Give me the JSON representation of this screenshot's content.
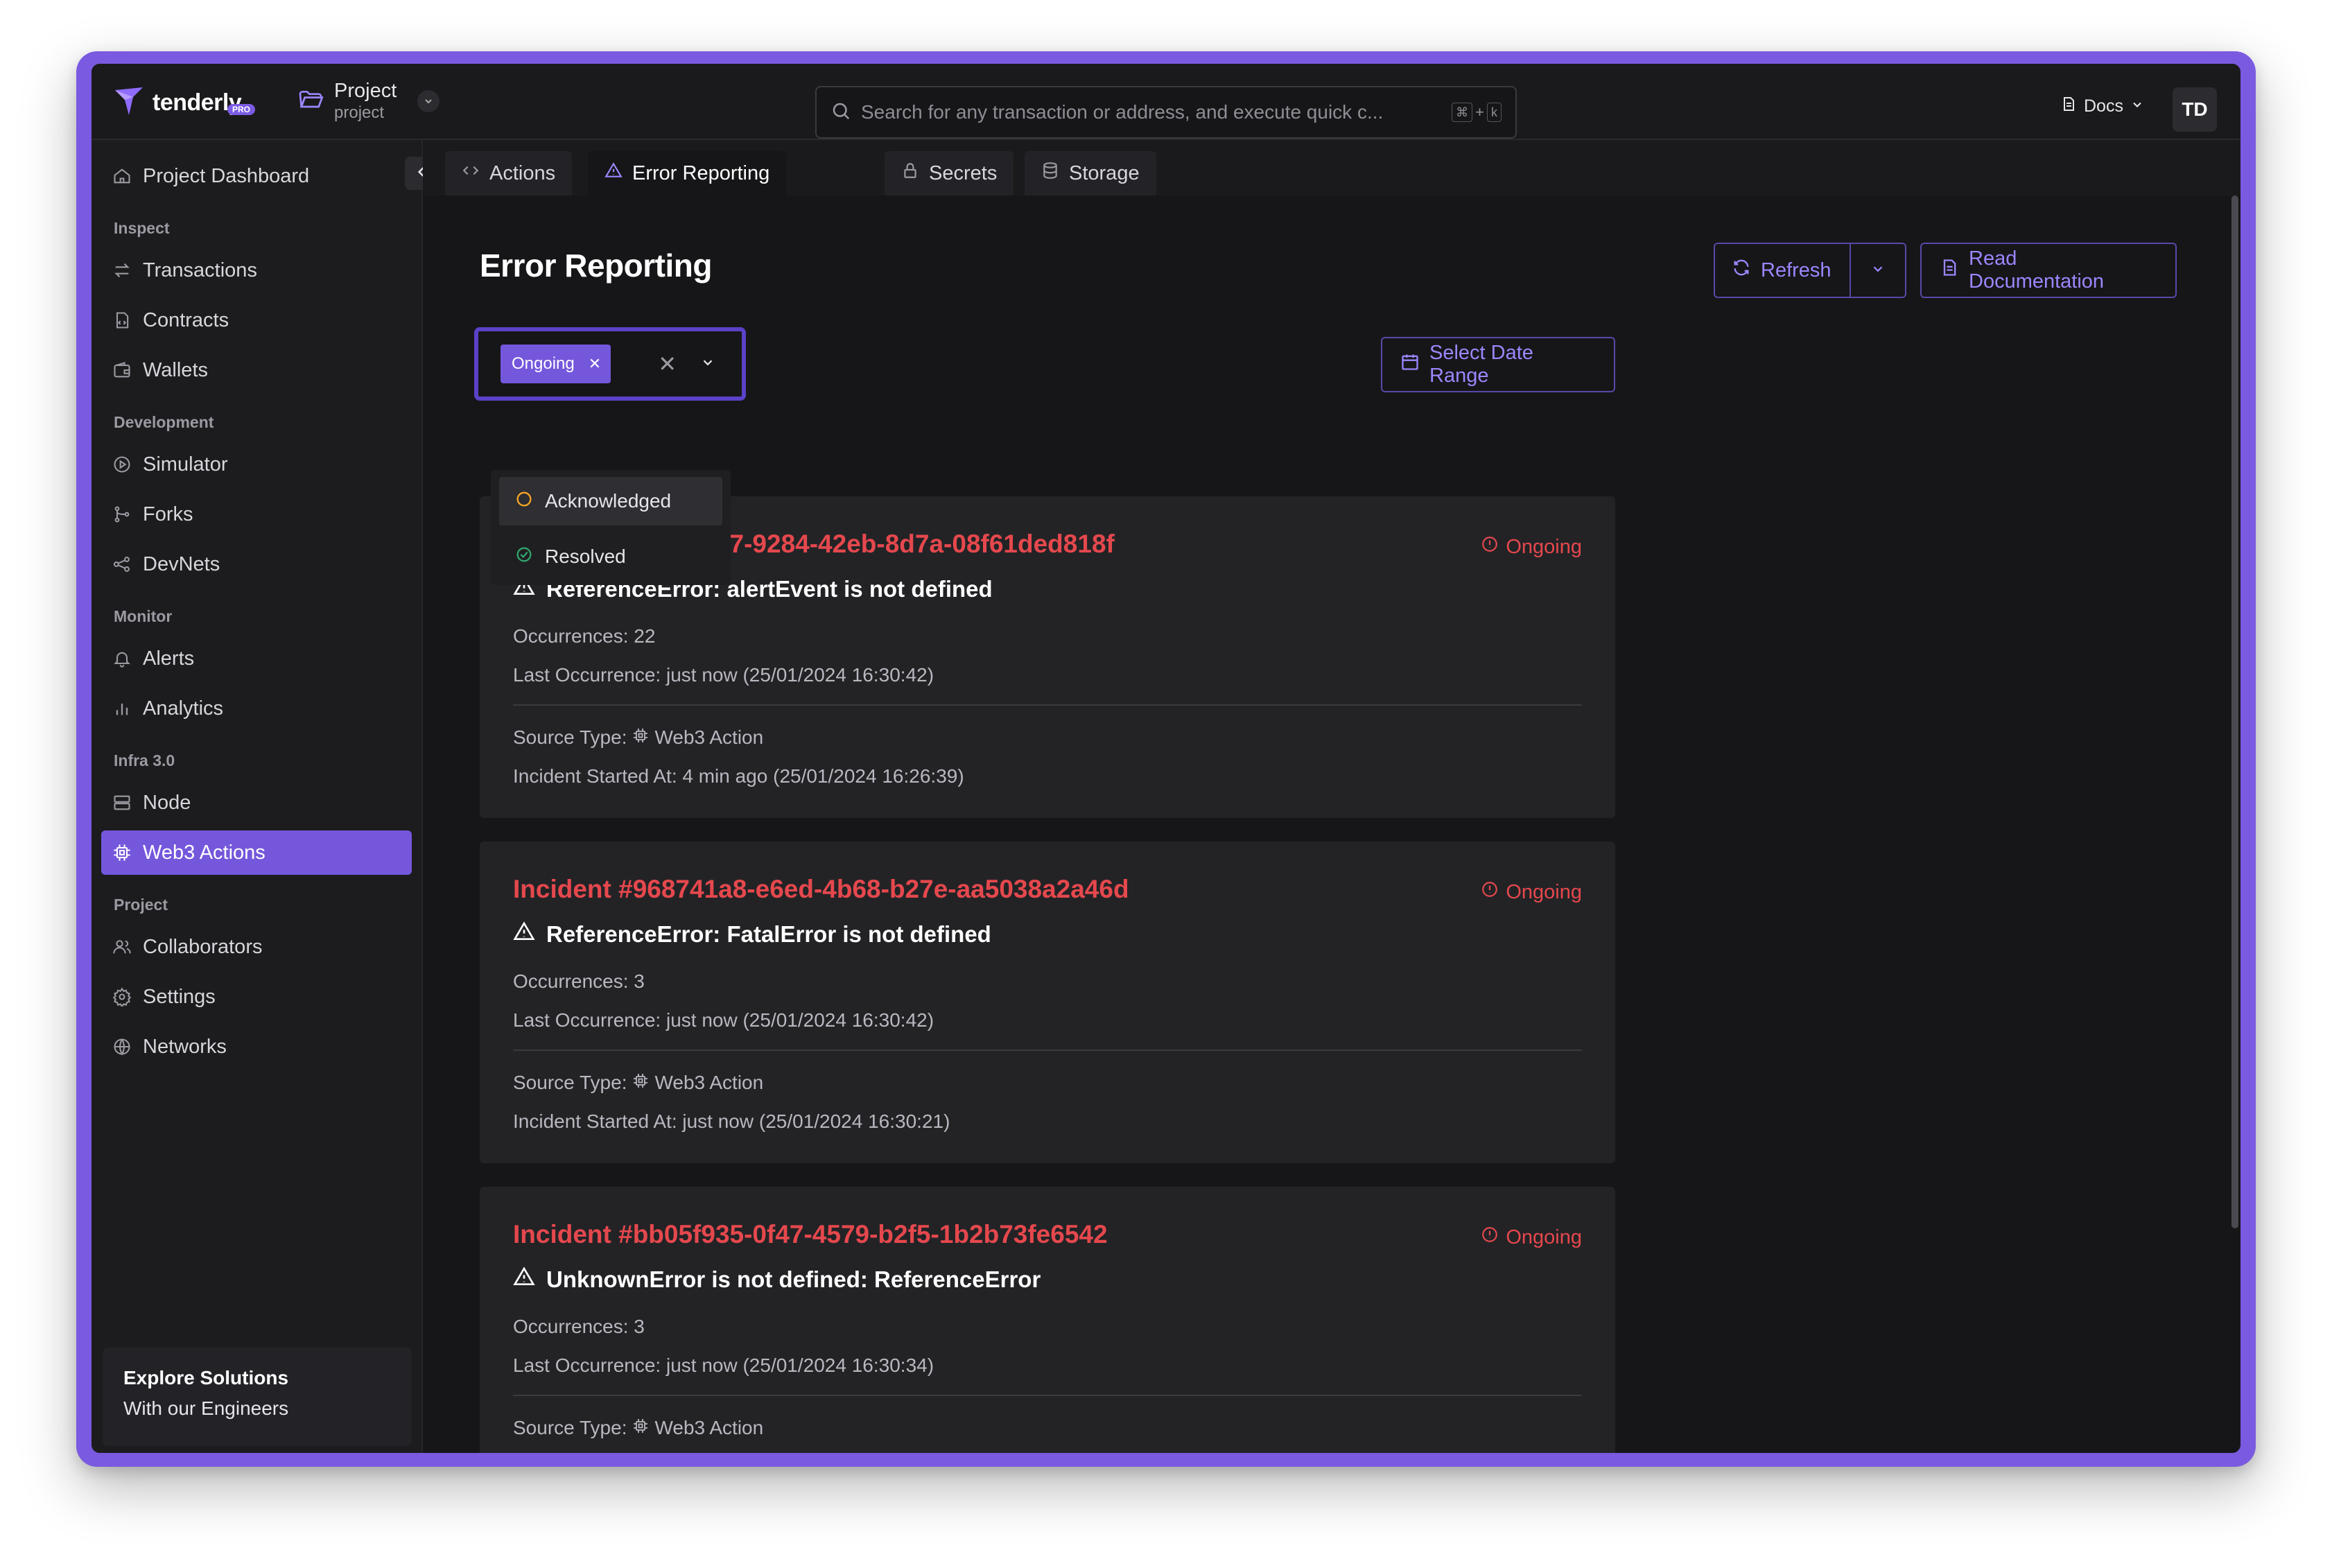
{
  "app": {
    "logo_text": "tenderly",
    "logo_badge": "PRO",
    "project_name": "Project",
    "project_sub": "project",
    "avatar_initials": "TD",
    "docs_label": "Docs"
  },
  "search": {
    "placeholder": "Search for any transaction or address, and execute quick c...",
    "shortcut_key1": "⌘",
    "shortcut_plus": "+",
    "shortcut_key2": "k"
  },
  "sidebar": {
    "dashboard": "Project Dashboard",
    "sections": {
      "inspect": "Inspect",
      "development": "Development",
      "monitor": "Monitor",
      "infra": "Infra 3.0",
      "project": "Project"
    },
    "items": {
      "transactions": "Transactions",
      "contracts": "Contracts",
      "wallets": "Wallets",
      "simulator": "Simulator",
      "forks": "Forks",
      "devnets": "DevNets",
      "alerts": "Alerts",
      "analytics": "Analytics",
      "node": "Node",
      "web3_actions": "Web3 Actions",
      "collaborators": "Collaborators",
      "settings": "Settings",
      "networks": "Networks"
    },
    "explore_title": "Explore Solutions",
    "explore_sub": "With our Engineers"
  },
  "tabs": [
    {
      "label": "Actions"
    },
    {
      "label": "Error Reporting"
    },
    {
      "label": "Secrets"
    },
    {
      "label": "Storage"
    }
  ],
  "main": {
    "title": "Error Reporting",
    "refresh_label": "Refresh",
    "docs_label": "Read Documentation",
    "date_range_label": "Select Date Range"
  },
  "filter": {
    "selected_chip": "Ongoing",
    "options": [
      {
        "label": "Acknowledged"
      },
      {
        "label": "Resolved"
      }
    ]
  },
  "incidents": [
    {
      "title": "Incident #f4b86b17-9284-42eb-8d7a-08f61ded818f",
      "status": "Ongoing",
      "error": "ReferenceError: alertEvent is not defined",
      "occurrences": "Occurrences: 22",
      "last_occurrence": "Last Occurrence: just now (25/01/2024 16:30:42)",
      "source_prefix": "Source Type:",
      "source_type": "Web3 Action",
      "started_at": "Incident Started At: 4 min ago (25/01/2024 16:26:39)"
    },
    {
      "title": "Incident #968741a8-e6ed-4b68-b27e-aa5038a2a46d",
      "status": "Ongoing",
      "error": "ReferenceError: FatalError is not defined",
      "occurrences": "Occurrences: 3",
      "last_occurrence": "Last Occurrence: just now (25/01/2024 16:30:42)",
      "source_prefix": "Source Type:",
      "source_type": "Web3 Action",
      "started_at": "Incident Started At: just now (25/01/2024 16:30:21)"
    },
    {
      "title": "Incident #bb05f935-0f47-4579-b2f5-1b2b73fe6542",
      "status": "Ongoing",
      "error": "UnknownError is not defined: ReferenceError",
      "occurrences": "Occurrences: 3",
      "last_occurrence": "Last Occurrence: just now (25/01/2024 16:30:34)",
      "source_prefix": "Source Type:",
      "source_type": "Web3 Action"
    }
  ],
  "colors": {
    "accent": "#7557dc",
    "error": "#e5484d",
    "background": "#161618",
    "frame": "#7a5ae0"
  }
}
